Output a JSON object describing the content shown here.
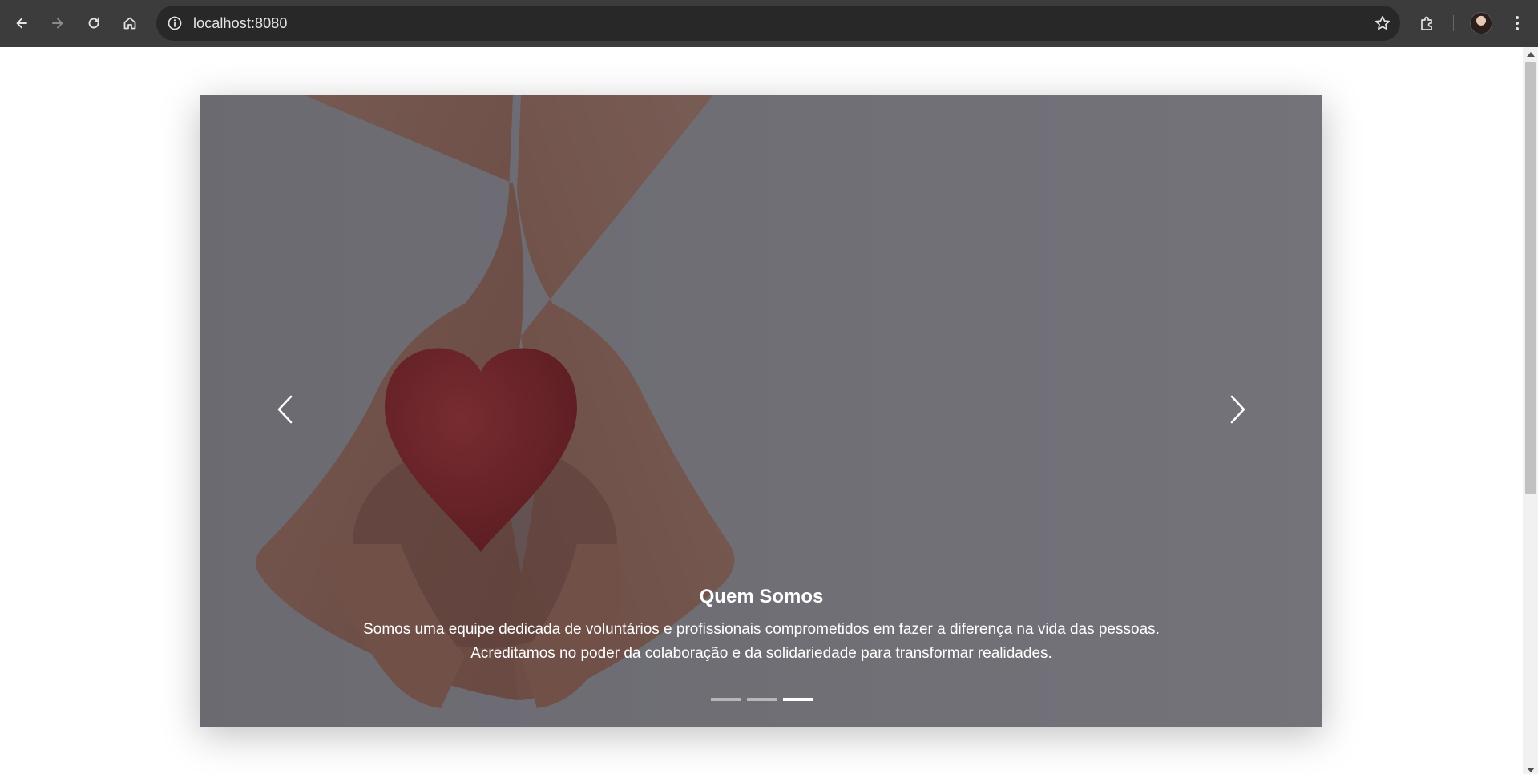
{
  "browser": {
    "url": "localhost:8080",
    "icons": {
      "back": "arrow-left-icon",
      "forward": "arrow-right-icon",
      "reload": "reload-icon",
      "home": "home-icon",
      "site_info": "info-icon",
      "bookmark": "star-icon",
      "extensions": "puzzle-icon",
      "menu": "kebab-menu-icon"
    }
  },
  "carousel": {
    "slide": {
      "title": "Quem Somos",
      "text": "Somos uma equipe dedicada de voluntários e profissionais comprometidos em fazer a diferença na vida das pessoas. Acreditamos no poder da colaboração e da solidariedade para transformar realidades."
    },
    "indicator_count": 3,
    "active_indicator": 3,
    "colors": {
      "heart": "#b01c1c",
      "overlay": "#2a2830"
    }
  }
}
